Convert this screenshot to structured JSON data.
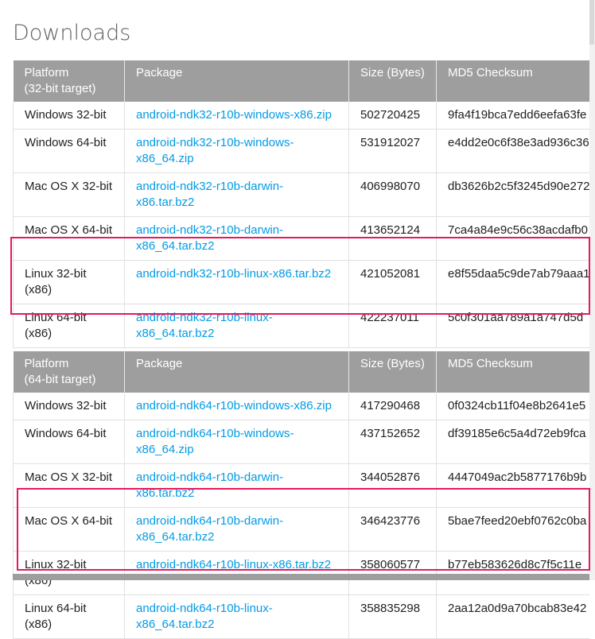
{
  "page": {
    "title": "Downloads"
  },
  "headers": {
    "platform_32": "Platform\n(32-bit target)",
    "platform_64": "Platform\n(64-bit target)",
    "package": "Package",
    "size": "Size (Bytes)",
    "md5": "MD5 Checksum"
  },
  "tables": [
    {
      "rows": [
        {
          "platform": "Windows 32-bit",
          "package": "android-ndk32-r10b-windows-x86.zip",
          "size": "502720425",
          "md5": "9fa4f19bca7edd6eefa63fe"
        },
        {
          "platform": "Windows 64-bit",
          "package": "android-ndk32-r10b-windows-x86_64.zip",
          "size": "531912027",
          "md5": "e4dd2e0c6f38e3ad936c36"
        },
        {
          "platform": "Mac OS X 32-bit",
          "package": "android-ndk32-r10b-darwin-x86.tar.bz2",
          "size": "406998070",
          "md5": "db3626b2c5f3245d90e272"
        },
        {
          "platform": "Mac OS X 64-bit",
          "package": "android-ndk32-r10b-darwin-x86_64.tar.bz2",
          "size": "413652124",
          "md5": "7ca4a84e9c56c38acdafb0"
        },
        {
          "platform": "Linux 32-bit (x86)",
          "package": "android-ndk32-r10b-linux-x86.tar.bz2",
          "size": "421052081",
          "md5": "e8f55daa5c9de7ab79aaa1"
        },
        {
          "platform": "Linux 64-bit (x86)",
          "package": "android-ndk32-r10b-linux-x86_64.tar.bz2",
          "size": "422237011",
          "md5": "5c0f301aa789a1a747d5d"
        }
      ]
    },
    {
      "rows": [
        {
          "platform": "Windows 32-bit",
          "package": "android-ndk64-r10b-windows-x86.zip",
          "size": "417290468",
          "md5": "0f0324cb11f04e8b2641e5"
        },
        {
          "platform": "Windows 64-bit",
          "package": "android-ndk64-r10b-windows-x86_64.zip",
          "size": "437152652",
          "md5": "df39185e6c5a4d72eb9fca"
        },
        {
          "platform": "Mac OS X 32-bit",
          "package": "android-ndk64-r10b-darwin-x86.tar.bz2",
          "size": "344052876",
          "md5": "4447049ac2b5877176b9b"
        },
        {
          "platform": "Mac OS X 64-bit",
          "package": "android-ndk64-r10b-darwin-x86_64.tar.bz2",
          "size": "346423776",
          "md5": "5bae7feed20ebf0762c0ba"
        },
        {
          "platform": "Linux 32-bit (x86)",
          "package": "android-ndk64-r10b-linux-x86.tar.bz2",
          "size": "358060577",
          "md5": "b77eb583626d8c7f5c11e"
        },
        {
          "platform": "Linux 64-bit (x86)",
          "package": "android-ndk64-r10b-linux-x86_64.tar.bz2",
          "size": "358835298",
          "md5": "2aa12a0d9a70bcab83e42"
        }
      ]
    }
  ],
  "colors": {
    "header_bg": "#9e9e9e",
    "link": "#039be5",
    "highlight": "#e8185b",
    "title": "#616161"
  }
}
